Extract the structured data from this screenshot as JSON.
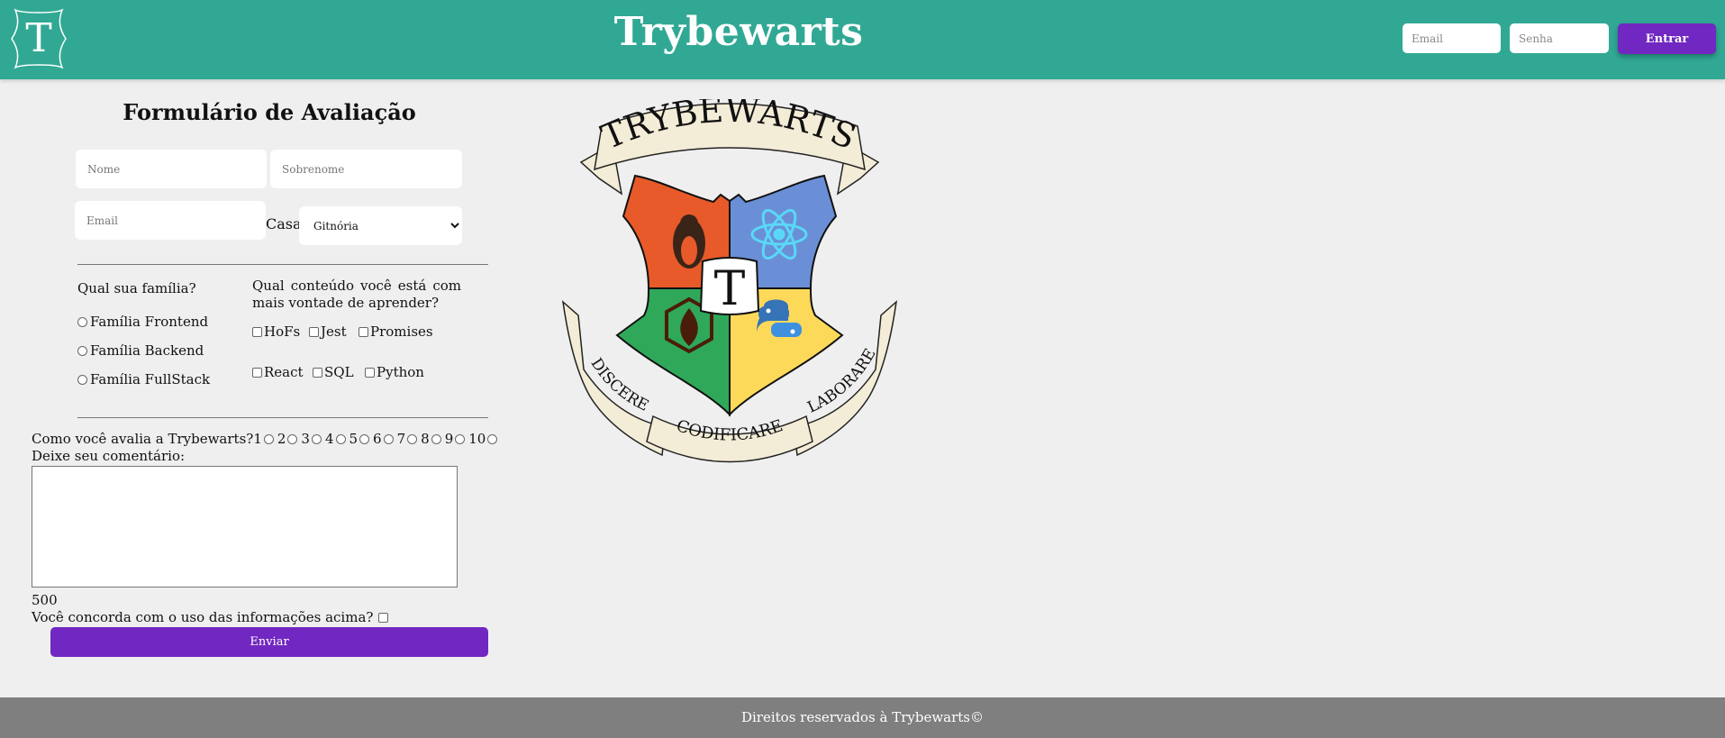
{
  "header": {
    "logo_letter": "T",
    "brand": "Trybewarts",
    "email_placeholder": "Email",
    "password_placeholder": "Senha",
    "login_button": "Entrar",
    "color": "#31a894",
    "button_color": "#7127c1"
  },
  "form": {
    "title": "Formulário de Avaliação",
    "name_placeholder": "Nome",
    "lastname_placeholder": "Sobrenome",
    "email_placeholder": "Email",
    "house_label": "Casa:",
    "house_selected": "Gitnória",
    "family_question": "Qual sua família?",
    "families": [
      "Família Frontend",
      "Família Backend",
      "Família FullStack"
    ],
    "content_question": "Qual conteúdo você está com mais vontade de aprender?",
    "contents_row1": [
      "HoFs",
      "Jest",
      "Promises"
    ],
    "contents_row2": [
      "React",
      "SQL",
      "Python"
    ],
    "rating_question": "Como você avalia a Trybewarts?",
    "ratings": [
      "1",
      "2",
      "3",
      "4",
      "5",
      "6",
      "7",
      "8",
      "9",
      "10"
    ],
    "comment_label": "Deixe seu comentário:",
    "counter": "500",
    "agree_label": "Você concorda com o uso das informações acima?",
    "submit_button": "Enviar"
  },
  "crest": {
    "banner_text": "TRYBEWARTS",
    "center_letter": "T",
    "motto": [
      "DISCERE",
      "CODIFICARE",
      "LABORARE"
    ],
    "colors": {
      "orange": "#e85a2a",
      "blue": "#6a8fd6",
      "green": "#2fa85a",
      "yellow": "#fdd95a",
      "ribbon": "#f3ecd6"
    },
    "icons": [
      "linux-penguin-icon",
      "react-atom-icon",
      "mongodb-leaf-icon",
      "python-icon"
    ]
  },
  "footer": {
    "text": "Direitos reservados à Trybewarts©"
  }
}
